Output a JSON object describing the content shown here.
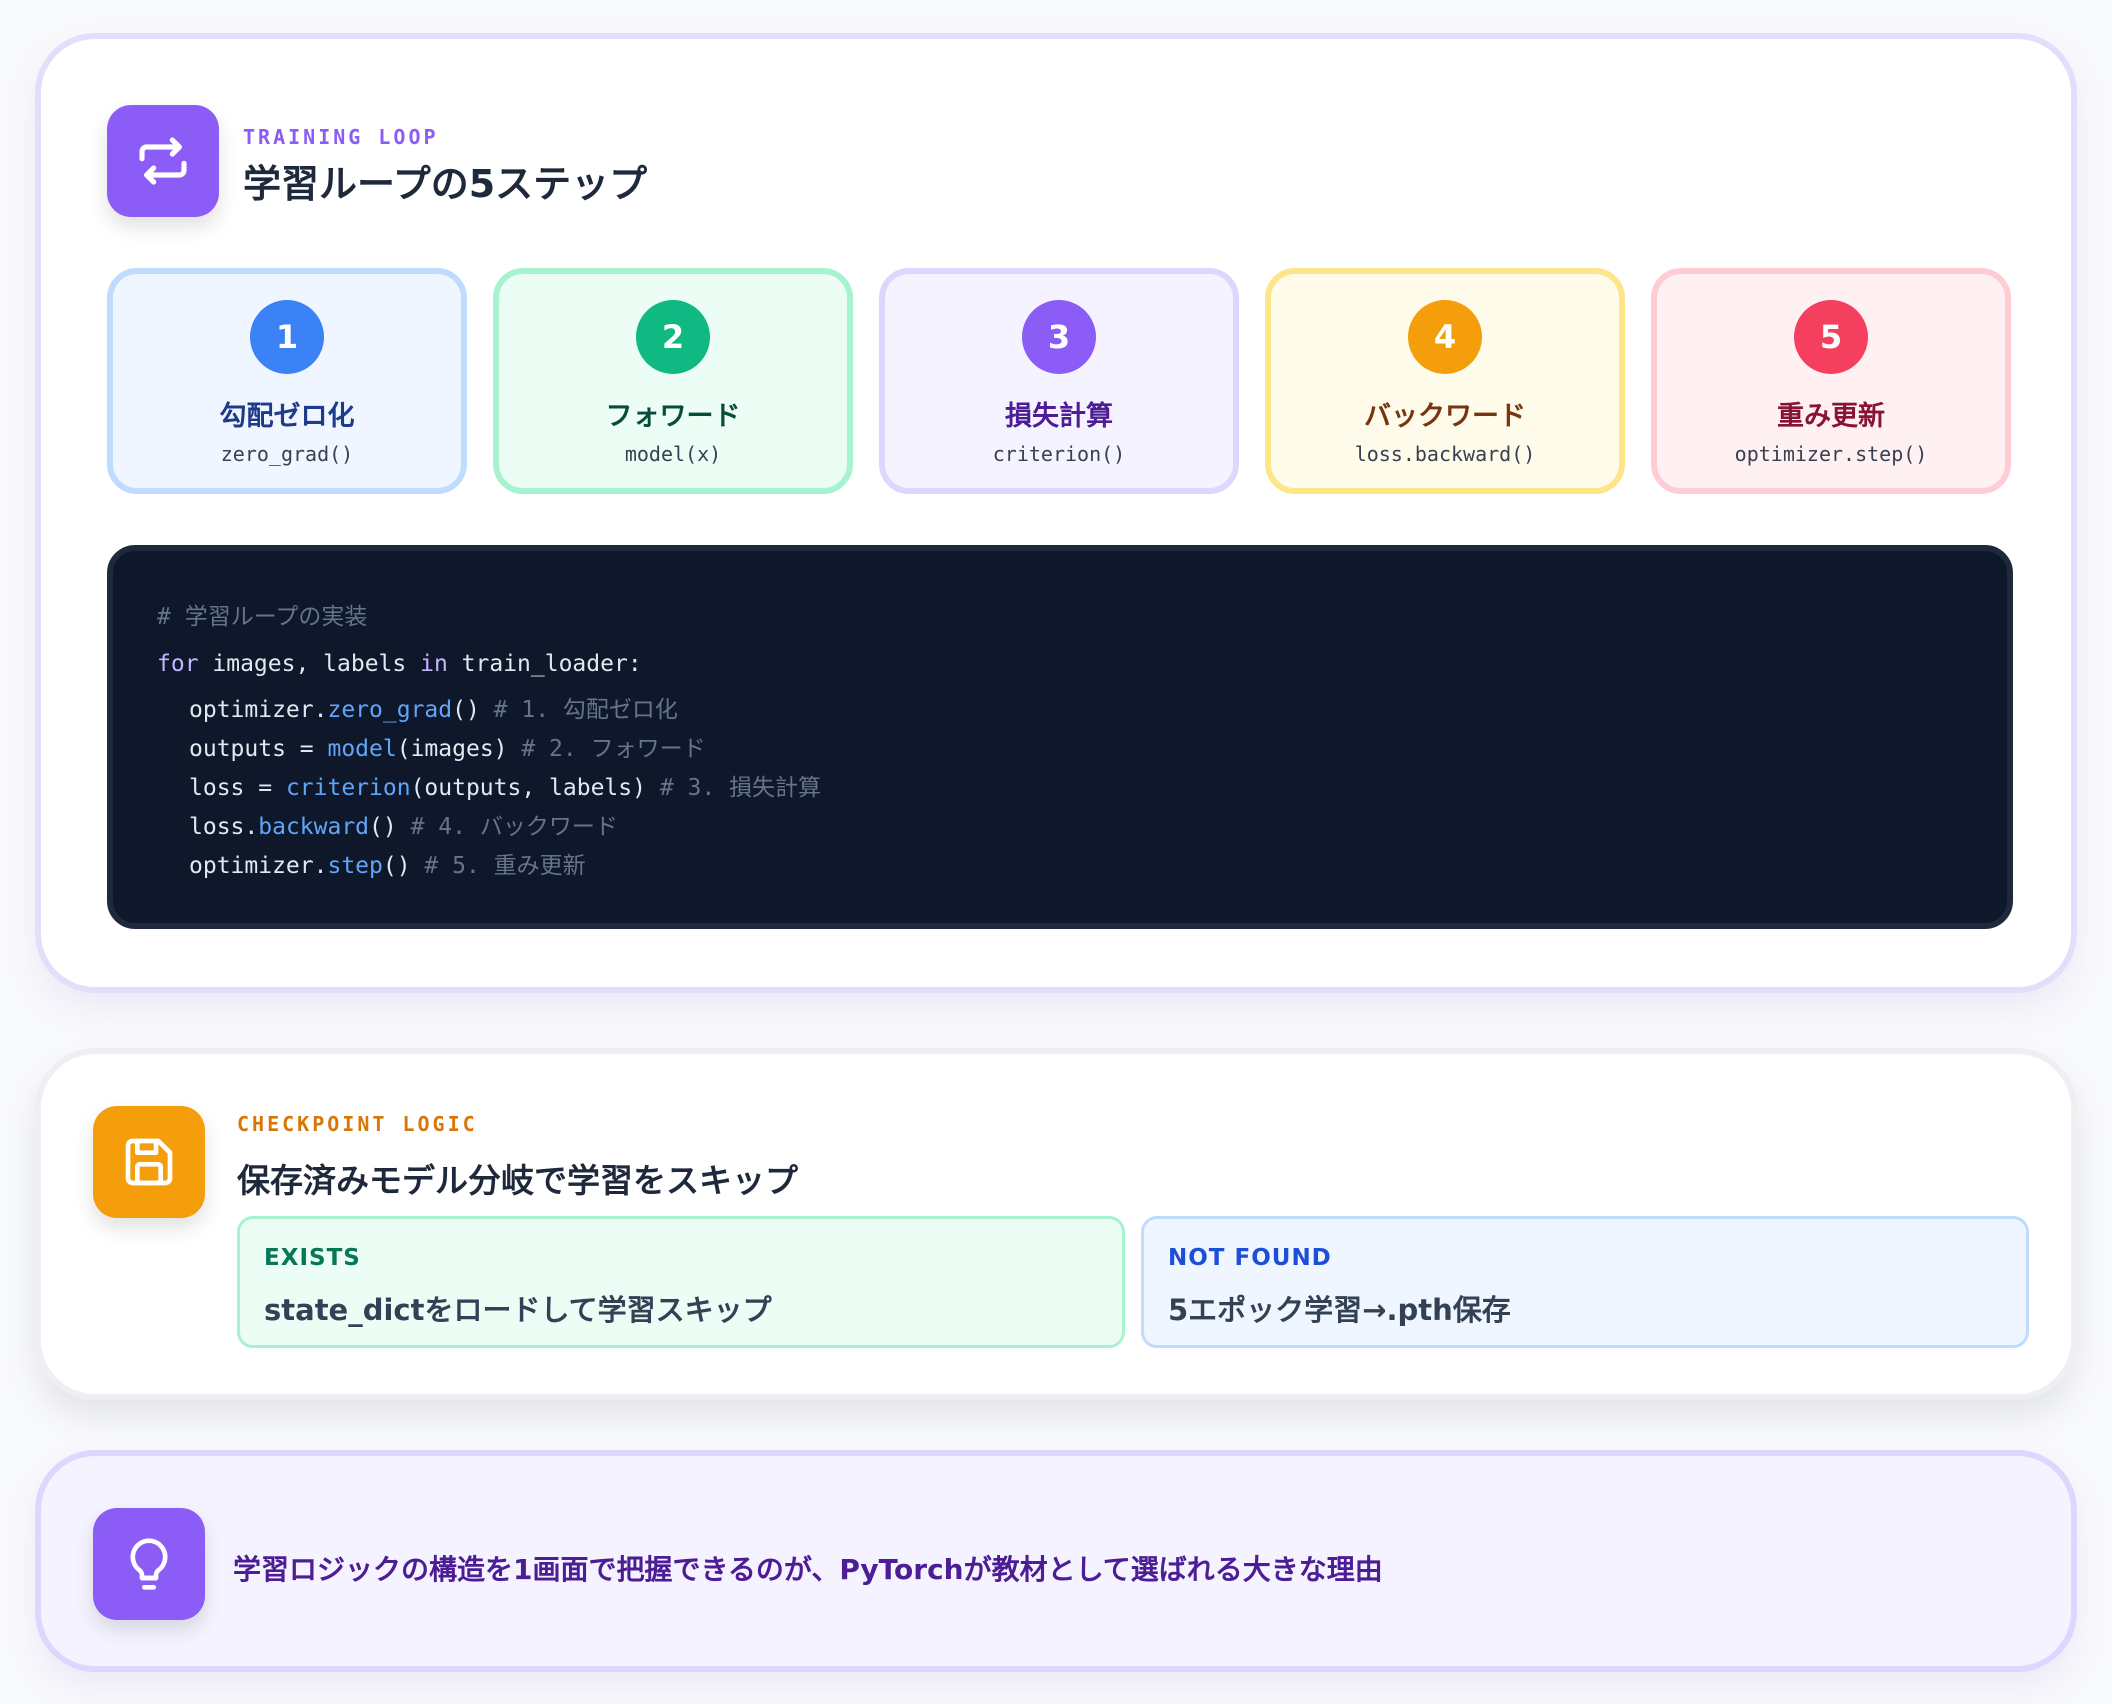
{
  "training_loop": {
    "eyebrow": "TRAINING LOOP",
    "title": "学習ループの5ステップ",
    "icon": "repeat-icon",
    "steps": [
      {
        "number": "1",
        "title": "勾配ゼロ化",
        "fn": "zero_grad()",
        "color": "#3b82f6"
      },
      {
        "number": "2",
        "title": "フォワード",
        "fn": "model(x)",
        "color": "#10b981"
      },
      {
        "number": "3",
        "title": "損失計算",
        "fn": "criterion()",
        "color": "#8b5cf6"
      },
      {
        "number": "4",
        "title": "バックワード",
        "fn": "loss.backward()",
        "color": "#f59e0b"
      },
      {
        "number": "5",
        "title": "重み更新",
        "fn": "optimizer.step()",
        "color": "#f43f5e"
      }
    ],
    "code": {
      "comment_header": "# 学習ループの実装",
      "loop_kw_for": "for",
      "loop_vars": " images, labels ",
      "loop_kw_in": "in",
      "loop_iter": " train_loader:",
      "lines": [
        {
          "pre": "optimizer.",
          "fn": "zero_grad",
          "post": "()",
          "comment": " # 1. 勾配ゼロ化"
        },
        {
          "pre": "outputs = ",
          "fn": "model",
          "post": "(images)",
          "comment": " # 2. フォワード"
        },
        {
          "pre": "loss = ",
          "fn": "criterion",
          "post": "(outputs, labels)",
          "comment": " # 3. 損失計算"
        },
        {
          "pre": "loss.",
          "fn": "backward",
          "post": "()",
          "comment": " # 4. バックワード"
        },
        {
          "pre": "optimizer.",
          "fn": "step",
          "post": "()",
          "comment": " # 5. 重み更新"
        }
      ]
    }
  },
  "checkpoint": {
    "eyebrow": "CHECKPOINT LOGIC",
    "title": "保存済みモデル分岐で学習をスキップ",
    "icon": "save-icon",
    "exists": {
      "label": "EXISTS",
      "text": "state_dictをロードして学習スキップ"
    },
    "not_found": {
      "label": "NOT FOUND",
      "text": "5エポック学習→.pth保存"
    }
  },
  "tip": {
    "icon": "lightbulb-icon",
    "text": "学習ロジックの構造を1画面で把握できるのが、PyTorchが教材として選ばれる大きな理由"
  }
}
